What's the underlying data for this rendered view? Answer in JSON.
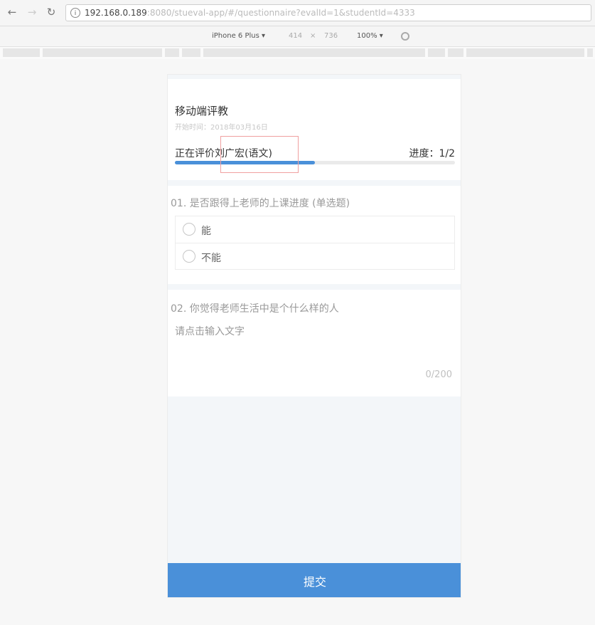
{
  "browser": {
    "back_icon": "back-arrow-icon",
    "forward_icon": "forward-arrow-icon",
    "reload_icon": "reload-icon",
    "url_host": "192.168.0.189",
    "url_rest": ":8080/stueval-app/#/questionnaire?evalId=1&studentId=4333"
  },
  "device_toolbar": {
    "device": "iPhone 6 Plus ▾",
    "width": "414",
    "times": "×",
    "height": "736",
    "zoom": "100% ▾",
    "rotate_icon": "rotate-icon"
  },
  "header": {
    "title": "移动端评教",
    "start_time": "开始时间：2018年03月16日",
    "evaluating": "正在评价刘广宏(语文)",
    "progress_label": "进度：1/2",
    "progress_fraction": 0.5,
    "accent": "#4a90d9"
  },
  "question1": {
    "text": "01. 是否跟得上老师的上课进度 (单选题)",
    "options": [
      {
        "label": "能"
      },
      {
        "label": "不能"
      }
    ]
  },
  "question2": {
    "text": "02. 你觉得老师生活中是个什么样的人",
    "placeholder": "请点击输入文字",
    "counter": "0/200"
  },
  "submit_label": "提交"
}
